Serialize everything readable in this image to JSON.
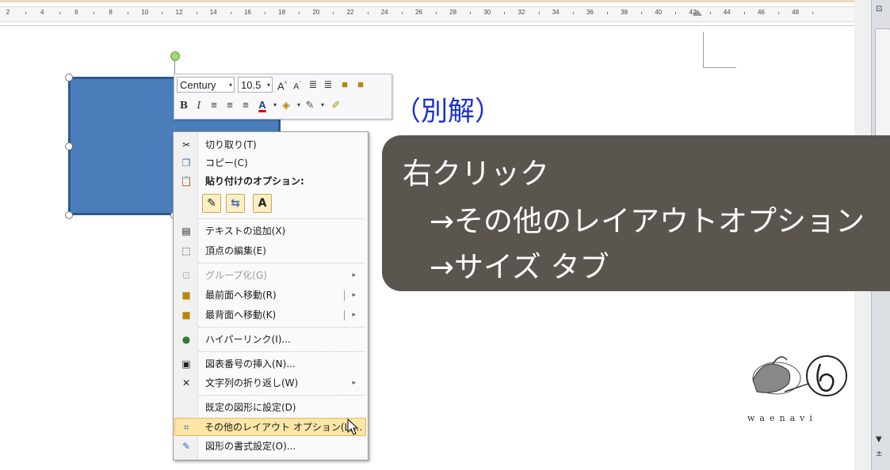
{
  "ruler": {
    "numbers": [
      "2",
      "4",
      "6",
      "8",
      "10",
      "12",
      "14",
      "16",
      "18",
      "20",
      "22",
      "24",
      "26",
      "28",
      "30",
      "32",
      "34",
      "36",
      "38",
      "40",
      "42",
      "44",
      "46",
      "48"
    ]
  },
  "mini_toolbar": {
    "font_name": "Century",
    "font_size": "10.5",
    "icons": [
      "grow-font-icon",
      "shrink-font-icon",
      "decrease-indent-icon",
      "increase-indent-icon",
      "bring-forward-icon",
      "send-backward-icon",
      "bold-icon",
      "italic-icon",
      "align-left-icon",
      "align-center-icon",
      "align-right-icon",
      "font-color-icon",
      "fill-color-icon",
      "line-color-icon",
      "format-painter-icon"
    ]
  },
  "annotation": "（別解）",
  "callout": {
    "line1": "右クリック",
    "line2": "→その他のレイアウトオプション",
    "line3": "→サイズ タブ"
  },
  "context_menu": {
    "items": [
      {
        "label": "切り取り(T)",
        "icon": "scissors-icon"
      },
      {
        "label": "コピー(C)",
        "icon": "copy-icon"
      },
      {
        "label": "貼り付けのオプション:",
        "icon": "paste-icon"
      },
      {
        "label": "テキストの追加(X)",
        "icon": "text-box-icon"
      },
      {
        "label": "頂点の編集(E)",
        "icon": "edit-points-icon"
      },
      {
        "label": "グループ化(G)",
        "icon": "group-icon"
      },
      {
        "label": "最前面へ移動(R)",
        "icon": "bring-to-front-icon"
      },
      {
        "label": "最背面へ移動(K)",
        "icon": "send-to-back-icon"
      },
      {
        "label": "ハイパーリンク(I)...",
        "icon": "hyperlink-icon"
      },
      {
        "label": "図表番号の挿入(N)...",
        "icon": "caption-icon"
      },
      {
        "label": "文字列の折り返し(W)",
        "icon": "wrap-text-icon"
      },
      {
        "label": "既定の図形に設定(D)",
        "icon": ""
      },
      {
        "label": "その他のレイアウト オプション(L)...",
        "icon": "layout-options-icon"
      },
      {
        "label": "図形の書式設定(O)...",
        "icon": "format-shape-icon"
      }
    ],
    "paste_options": [
      "paste-keep-format-icon",
      "paste-merge-icon",
      "paste-text-only-icon"
    ]
  },
  "logo": {
    "text": "waenavi"
  },
  "colors": {
    "shape_fill": "#4a7ebb",
    "callout_bg": "#5b5550",
    "annotation_text": "#1a2fd6",
    "menu_highlight": "#fde6a8"
  }
}
